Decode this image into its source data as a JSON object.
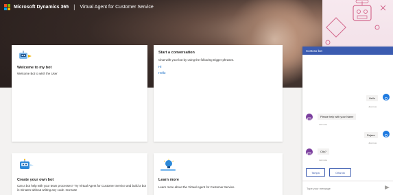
{
  "header": {
    "brand": "Microsoft Dynamics 365",
    "separator": "|",
    "product": "Virtual Agent for Customer Service",
    "logo_colors": [
      "#f25022",
      "#7fba00",
      "#00a4ef",
      "#ffb900"
    ]
  },
  "cards": {
    "welcome": {
      "icon": "robot-icon",
      "title": "Welcome to my bot",
      "text": "Welcome Bot to wish the User"
    },
    "conversation": {
      "title": "Start a conversation",
      "text": "Chat with your bot by using the following trigger phrases.",
      "phrases": [
        "Hi",
        "Hello"
      ]
    },
    "create": {
      "icon": "robot-icon",
      "title": "Create your own bot",
      "text": "Can a bot help with your team processes? Try Virtual Agent for Customer Service and build a bot in minutes without writing any code. Increase"
    },
    "learn": {
      "icon": "lightbulb-icon",
      "title": "Learn more",
      "text": "Learn more about the Virtual Agent for Customer Service."
    }
  },
  "chat": {
    "title": "Contoso bot",
    "messages": [
      {
        "from": "user",
        "text": "Hello",
        "time": "Just now"
      },
      {
        "from": "bot",
        "text": "Please help with your Name",
        "time": "Just now"
      },
      {
        "from": "user",
        "text": "Rajeev",
        "time": "Just now"
      },
      {
        "from": "bot",
        "text": "City?",
        "time": "Just now"
      }
    ],
    "suggestions": [
      "Tampa",
      "Orlando"
    ],
    "input_placeholder": "Type your message",
    "accent": "#3b5bb0"
  }
}
